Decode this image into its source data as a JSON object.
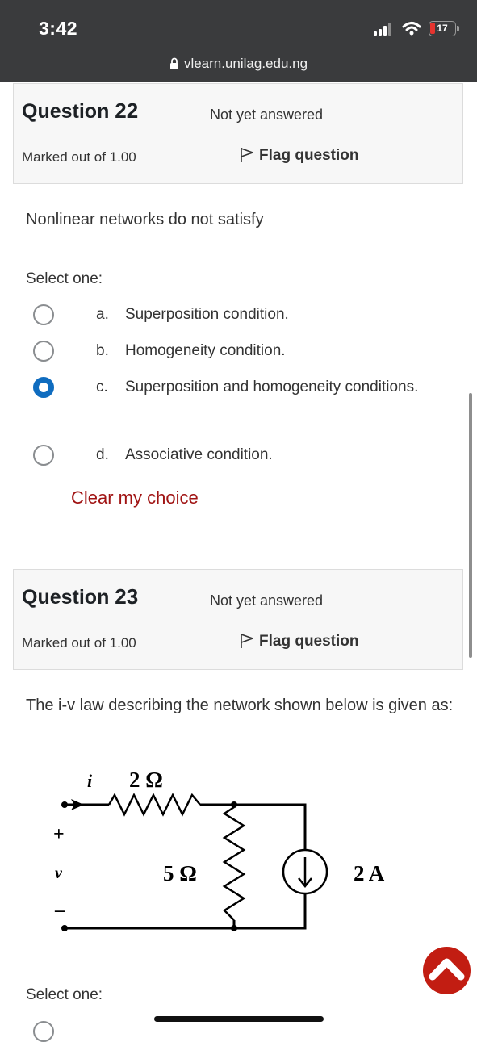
{
  "status_bar": {
    "time": "3:42",
    "url": "vlearn.unilag.edu.ng",
    "battery": "17"
  },
  "questions": [
    {
      "label": "Question",
      "number": "22",
      "state": "Not yet answered",
      "marked": "Marked out of 1.00",
      "flag_label": "Flag question",
      "text": "Nonlinear networks do not satisfy",
      "select_label": "Select one:",
      "options": [
        {
          "letter": "a.",
          "text": "Superposition condition.",
          "selected": false
        },
        {
          "letter": "b.",
          "text": "Homogeneity condition.",
          "selected": false
        },
        {
          "letter": "c.",
          "text": "Superposition and homogeneity conditions.",
          "selected": true
        },
        {
          "letter": "d.",
          "text": "Associative condition.",
          "selected": false
        }
      ],
      "clear_label": "Clear my choice"
    },
    {
      "label": "Question",
      "number": "23",
      "state": "Not yet answered",
      "marked": "Marked out of 1.00",
      "flag_label": "Flag question",
      "text": "The i-v law describing the network shown below is given as:",
      "select_label": "Select one:",
      "circuit": {
        "current_label": "i",
        "voltage_label": "v",
        "plus": "+",
        "minus": "–",
        "resistor_series": "2 Ω",
        "resistor_shunt": "5 Ω",
        "source": "2 A"
      }
    }
  ],
  "colors": {
    "accent": "#0f6cbf",
    "clear_link": "#a01313",
    "back_to_top": "#c21d12"
  }
}
